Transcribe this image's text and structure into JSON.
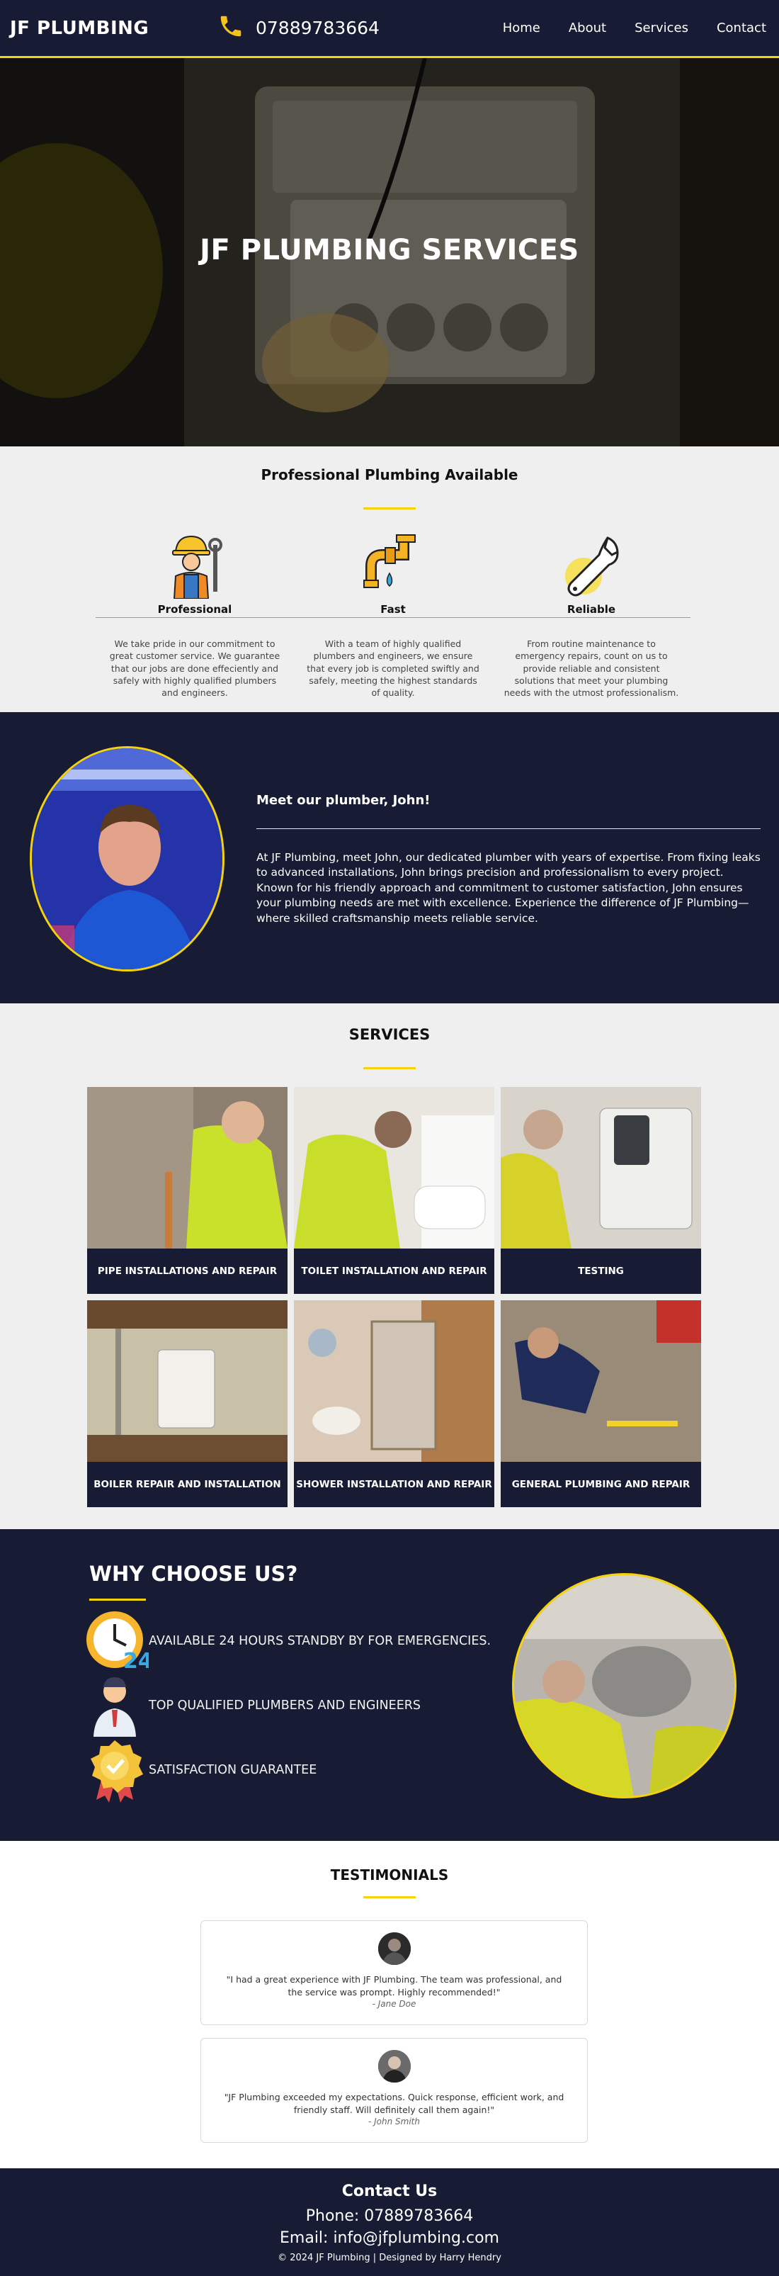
{
  "header": {
    "brand": "JF PLUMBING",
    "phone": "07889783664",
    "nav": [
      "Home",
      "About",
      "Services",
      "Contact"
    ]
  },
  "hero": {
    "title": "JF PLUMBING SERVICES"
  },
  "features": {
    "title": "Professional Plumbing Available",
    "items": [
      {
        "label": "Professional",
        "icon": "plumber-worker-icon",
        "desc": "We take pride in our commitment to great customer service. We guarantee that our jobs are done effeciently and safely with highly qualified plumbers and engineers."
      },
      {
        "label": "Fast",
        "icon": "pipe-faucet-icon",
        "desc": "With a team of highly qualified plumbers and engineers, we ensure that every job is completed swiftly and safely, meeting the highest standards of quality."
      },
      {
        "label": "Reliable",
        "icon": "wrench-icon",
        "desc": "From routine maintenance to emergency repairs, count on us to provide reliable and consistent solutions that meet your plumbing needs with the utmost professionalism."
      }
    ]
  },
  "john": {
    "heading": "Meet our plumber, John!",
    "text": "At JF Plumbing, meet John, our dedicated plumber with years of expertise. From fixing leaks to advanced installations, John brings precision and professionalism to every project. Known for his friendly approach and commitment to customer satisfaction, John ensures your plumbing needs are met with excellence. Experience the difference of JF Plumbing—where skilled craftsmanship meets reliable service."
  },
  "services": {
    "title": "SERVICES",
    "items": [
      {
        "caption": "PIPE INSTALLATIONS AND REPAIR"
      },
      {
        "caption": "TOILET INSTALLATION AND REPAIR"
      },
      {
        "caption": "TESTING"
      },
      {
        "caption": "BOILER REPAIR AND INSTALLATION"
      },
      {
        "caption": "SHOWER INSTALLATION AND REPAIR"
      },
      {
        "caption": "GENERAL PLUMBING AND REPAIR"
      }
    ]
  },
  "why": {
    "title": "WHY CHOOSE US?",
    "items": [
      {
        "text": "AVAILABLE 24 HOURS STANDBY BY FOR EMERGENCIES.",
        "icon": "clock-24-icon"
      },
      {
        "text": "TOP QUALIFIED PLUMBERS AND ENGINEERS",
        "icon": "engineer-person-icon"
      },
      {
        "text": "SATISFACTION GUARANTEE",
        "icon": "award-badge-icon"
      }
    ]
  },
  "testimonials": {
    "title": "TESTIMONIALS",
    "items": [
      {
        "quote": "\"I had a great experience with JF Plumbing. The team was professional, and the service was prompt. Highly recommended!\"",
        "author": "- Jane Doe"
      },
      {
        "quote": "\"JF Plumbing exceeded my expectations. Quick response, efficient work, and friendly staff. Will definitely call them again!\"",
        "author": "- John Smith"
      }
    ]
  },
  "footer": {
    "heading": "Contact Us",
    "phone": "Phone: 07889783664",
    "email": "Email: info@jfplumbing.com",
    "copyright": "© 2024 JF Plumbing | Designed by Harry Hendry"
  },
  "colors": {
    "navy": "#171b33",
    "accent": "#f4d20c",
    "light": "#efefef"
  }
}
